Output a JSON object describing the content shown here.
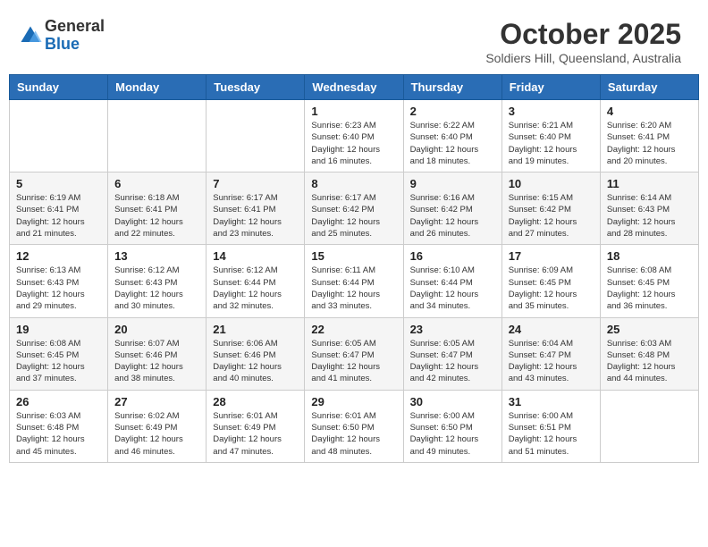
{
  "header": {
    "logo_general": "General",
    "logo_blue": "Blue",
    "month_title": "October 2025",
    "location": "Soldiers Hill, Queensland, Australia"
  },
  "weekdays": [
    "Sunday",
    "Monday",
    "Tuesday",
    "Wednesday",
    "Thursday",
    "Friday",
    "Saturday"
  ],
  "weeks": [
    [
      {
        "day": "",
        "info": ""
      },
      {
        "day": "",
        "info": ""
      },
      {
        "day": "",
        "info": ""
      },
      {
        "day": "1",
        "info": "Sunrise: 6:23 AM\nSunset: 6:40 PM\nDaylight: 12 hours\nand 16 minutes."
      },
      {
        "day": "2",
        "info": "Sunrise: 6:22 AM\nSunset: 6:40 PM\nDaylight: 12 hours\nand 18 minutes."
      },
      {
        "day": "3",
        "info": "Sunrise: 6:21 AM\nSunset: 6:40 PM\nDaylight: 12 hours\nand 19 minutes."
      },
      {
        "day": "4",
        "info": "Sunrise: 6:20 AM\nSunset: 6:41 PM\nDaylight: 12 hours\nand 20 minutes."
      }
    ],
    [
      {
        "day": "5",
        "info": "Sunrise: 6:19 AM\nSunset: 6:41 PM\nDaylight: 12 hours\nand 21 minutes."
      },
      {
        "day": "6",
        "info": "Sunrise: 6:18 AM\nSunset: 6:41 PM\nDaylight: 12 hours\nand 22 minutes."
      },
      {
        "day": "7",
        "info": "Sunrise: 6:17 AM\nSunset: 6:41 PM\nDaylight: 12 hours\nand 23 minutes."
      },
      {
        "day": "8",
        "info": "Sunrise: 6:17 AM\nSunset: 6:42 PM\nDaylight: 12 hours\nand 25 minutes."
      },
      {
        "day": "9",
        "info": "Sunrise: 6:16 AM\nSunset: 6:42 PM\nDaylight: 12 hours\nand 26 minutes."
      },
      {
        "day": "10",
        "info": "Sunrise: 6:15 AM\nSunset: 6:42 PM\nDaylight: 12 hours\nand 27 minutes."
      },
      {
        "day": "11",
        "info": "Sunrise: 6:14 AM\nSunset: 6:43 PM\nDaylight: 12 hours\nand 28 minutes."
      }
    ],
    [
      {
        "day": "12",
        "info": "Sunrise: 6:13 AM\nSunset: 6:43 PM\nDaylight: 12 hours\nand 29 minutes."
      },
      {
        "day": "13",
        "info": "Sunrise: 6:12 AM\nSunset: 6:43 PM\nDaylight: 12 hours\nand 30 minutes."
      },
      {
        "day": "14",
        "info": "Sunrise: 6:12 AM\nSunset: 6:44 PM\nDaylight: 12 hours\nand 32 minutes."
      },
      {
        "day": "15",
        "info": "Sunrise: 6:11 AM\nSunset: 6:44 PM\nDaylight: 12 hours\nand 33 minutes."
      },
      {
        "day": "16",
        "info": "Sunrise: 6:10 AM\nSunset: 6:44 PM\nDaylight: 12 hours\nand 34 minutes."
      },
      {
        "day": "17",
        "info": "Sunrise: 6:09 AM\nSunset: 6:45 PM\nDaylight: 12 hours\nand 35 minutes."
      },
      {
        "day": "18",
        "info": "Sunrise: 6:08 AM\nSunset: 6:45 PM\nDaylight: 12 hours\nand 36 minutes."
      }
    ],
    [
      {
        "day": "19",
        "info": "Sunrise: 6:08 AM\nSunset: 6:45 PM\nDaylight: 12 hours\nand 37 minutes."
      },
      {
        "day": "20",
        "info": "Sunrise: 6:07 AM\nSunset: 6:46 PM\nDaylight: 12 hours\nand 38 minutes."
      },
      {
        "day": "21",
        "info": "Sunrise: 6:06 AM\nSunset: 6:46 PM\nDaylight: 12 hours\nand 40 minutes."
      },
      {
        "day": "22",
        "info": "Sunrise: 6:05 AM\nSunset: 6:47 PM\nDaylight: 12 hours\nand 41 minutes."
      },
      {
        "day": "23",
        "info": "Sunrise: 6:05 AM\nSunset: 6:47 PM\nDaylight: 12 hours\nand 42 minutes."
      },
      {
        "day": "24",
        "info": "Sunrise: 6:04 AM\nSunset: 6:47 PM\nDaylight: 12 hours\nand 43 minutes."
      },
      {
        "day": "25",
        "info": "Sunrise: 6:03 AM\nSunset: 6:48 PM\nDaylight: 12 hours\nand 44 minutes."
      }
    ],
    [
      {
        "day": "26",
        "info": "Sunrise: 6:03 AM\nSunset: 6:48 PM\nDaylight: 12 hours\nand 45 minutes."
      },
      {
        "day": "27",
        "info": "Sunrise: 6:02 AM\nSunset: 6:49 PM\nDaylight: 12 hours\nand 46 minutes."
      },
      {
        "day": "28",
        "info": "Sunrise: 6:01 AM\nSunset: 6:49 PM\nDaylight: 12 hours\nand 47 minutes."
      },
      {
        "day": "29",
        "info": "Sunrise: 6:01 AM\nSunset: 6:50 PM\nDaylight: 12 hours\nand 48 minutes."
      },
      {
        "day": "30",
        "info": "Sunrise: 6:00 AM\nSunset: 6:50 PM\nDaylight: 12 hours\nand 49 minutes."
      },
      {
        "day": "31",
        "info": "Sunrise: 6:00 AM\nSunset: 6:51 PM\nDaylight: 12 hours\nand 51 minutes."
      },
      {
        "day": "",
        "info": ""
      }
    ]
  ]
}
